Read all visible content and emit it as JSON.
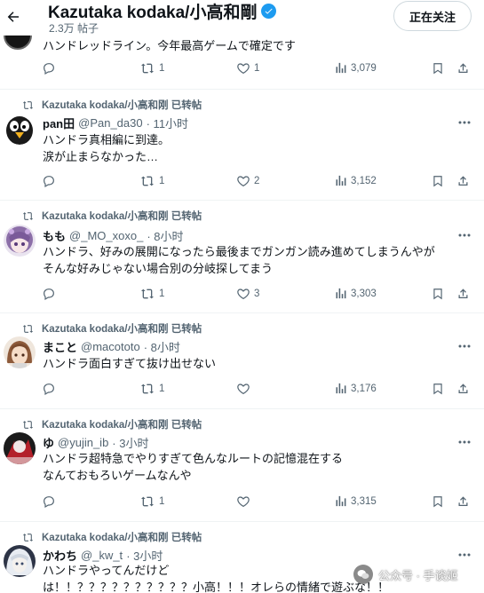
{
  "header": {
    "title": "Kazutaka kodaka/小高和剛",
    "subtitle": "2.3万 帖子",
    "follow_label": "正在关注"
  },
  "top_post": {
    "text": "ハンドレッドライン。今年最高ゲームで確定です",
    "reply_count": "",
    "retweet_count": "1",
    "like_count": "1",
    "view_count": "3,079"
  },
  "posts": [
    {
      "retweet_label": "Kazutaka kodaka/小高和刚 已转帖",
      "name": "pan田",
      "handle": "@Pan_da30",
      "time": "· 11小时",
      "lines": [
        "ハンドラ真相編に到達。",
        "涙が止まらなかった…"
      ],
      "retweet_count": "1",
      "like_count": "2",
      "view_count": "3,152",
      "avatar": "penguin-avatar"
    },
    {
      "retweet_label": "Kazutaka kodaka/小高和刚 已转帖",
      "name": "もも",
      "handle": "@_MO_xoxo_",
      "time": "· 8小时",
      "lines": [
        "ハンドラ、好みの展開になったら最後までガンガン読み進めてしまうんやが",
        "そんな好みじゃない場合別の分岐探してまう"
      ],
      "retweet_count": "1",
      "like_count": "3",
      "view_count": "3,303",
      "avatar": "anime-girl-avatar"
    },
    {
      "retweet_label": "Kazutaka kodaka/小高和刚 已转帖",
      "name": "まこと",
      "handle": "@macototo",
      "time": "· 8小时",
      "lines": [
        "ハンドラ面白すぎて抜け出せない"
      ],
      "retweet_count": "1",
      "like_count": "",
      "view_count": "3,176",
      "avatar": "brown-hair-avatar"
    },
    {
      "retweet_label": "Kazutaka kodaka/小高和刚 已转帖",
      "name": "ゆ",
      "handle": "@yujin_ib",
      "time": "· 3小时",
      "lines": [
        "ハンドラ超特急でやりすぎて色んなルートの記憶混在する",
        "なんておもろいゲームなんや"
      ],
      "retweet_count": "1",
      "like_count": "",
      "view_count": "3,315",
      "avatar": "red-dark-avatar"
    },
    {
      "retweet_label": "Kazutaka kodaka/小高和刚 已转帖",
      "name": "かわち",
      "handle": "@_kw_t",
      "time": "· 3小时",
      "lines": [
        "ハンドラやってんだけど",
        "は！！？？？？？？？？？？小高！！！オレらの情緒で遊ぶな！！"
      ],
      "retweet_count": "",
      "like_count": "",
      "view_count": "",
      "avatar": "white-hair-avatar"
    }
  ],
  "watermark": {
    "text": "公众号 · 手谈姬"
  },
  "colors": {
    "text": "#0f1419",
    "muted": "#536471",
    "verified": "#1d9bf0",
    "divider": "#eff3f4"
  }
}
